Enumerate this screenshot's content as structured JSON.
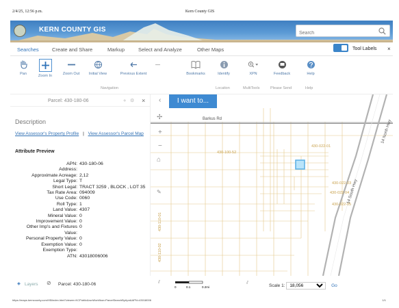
{
  "print_header": {
    "datetime": "2/4/25, 12:56 p.m.",
    "title": "Kern County GIS"
  },
  "banner": {
    "title": "KERN COUNTY GIS",
    "search_placeholder": "Search"
  },
  "tabs": [
    "Searches",
    "Create and Share",
    "Markup",
    "Select and Analyze",
    "Other Maps"
  ],
  "tool_labels_text": "Tool Labels",
  "toolbar": {
    "tools": [
      "Pan",
      "Zoom In",
      "Zoom Out",
      "Initial View",
      "Previous Extent",
      "Bookmarks",
      "Identify",
      "XPN",
      "Feedback",
      "Help"
    ],
    "groups": [
      "Navigation",
      "Location",
      "MultiTools",
      "Please Send",
      "Help"
    ]
  },
  "panel": {
    "header": "Parcel: 430-180-06",
    "description_title": "Description",
    "link_profile": "View Assessor's Property Profile",
    "link_separator": "|",
    "link_parcel": "View Assessor's Parcel Map",
    "attribute_title": "Attribute Preview",
    "attributes": [
      {
        "k": "APN:",
        "v": "430-180-06"
      },
      {
        "k": "Address:",
        "v": ""
      },
      {
        "k": "Approximate Acreage:",
        "v": "2,12"
      },
      {
        "k": "Legal Type:",
        "v": "T"
      },
      {
        "k": "Short Legal:",
        "v": "TRACT 3259 , BLOCK , LOT 35"
      },
      {
        "k": "Tax Rate Area:",
        "v": "094009"
      },
      {
        "k": "Use Code:",
        "v": "0060"
      },
      {
        "k": "Roll Type:",
        "v": "1"
      },
      {
        "k": "Land Value:",
        "v": "4307"
      },
      {
        "k": "Mineral Value:",
        "v": "0"
      },
      {
        "k": "Improvement Value:",
        "v": "0"
      },
      {
        "k": "Other Imp's and Fixtures Value:",
        "v": "0"
      },
      {
        "k": "Personal Property Value:",
        "v": "0"
      },
      {
        "k": "Exemption Value:",
        "v": "0"
      },
      {
        "k": "Exemption Type:",
        "v": ""
      },
      {
        "k": "ATN:",
        "v": "43018006006"
      }
    ]
  },
  "map": {
    "iwant": "I want to...",
    "road_barkus": "Barkus Rd",
    "road_14north": "14 North Hwy",
    "road_14south": "14 South Hwy",
    "parcel_labels": [
      "430-022-01",
      "430-100-52",
      "430-022-03",
      "430-022-04",
      "430-022-05",
      "430-110-01",
      "430-110-02"
    ]
  },
  "bottom": {
    "layers": "Layers",
    "parcel": "Parcel: 430-180-06",
    "scale_label": "Scale 1:",
    "scale_value": "18,056",
    "go": "Go",
    "scale_ticks": [
      "0",
      "0.1",
      "0.2mi"
    ]
  },
  "footer": {
    "url": "https://maps.kerncounty.com/H5/index.html?viewer=KCPublic&runWorkflow=ParcelSearchByApn&APN=43018006",
    "page": "1/1"
  }
}
